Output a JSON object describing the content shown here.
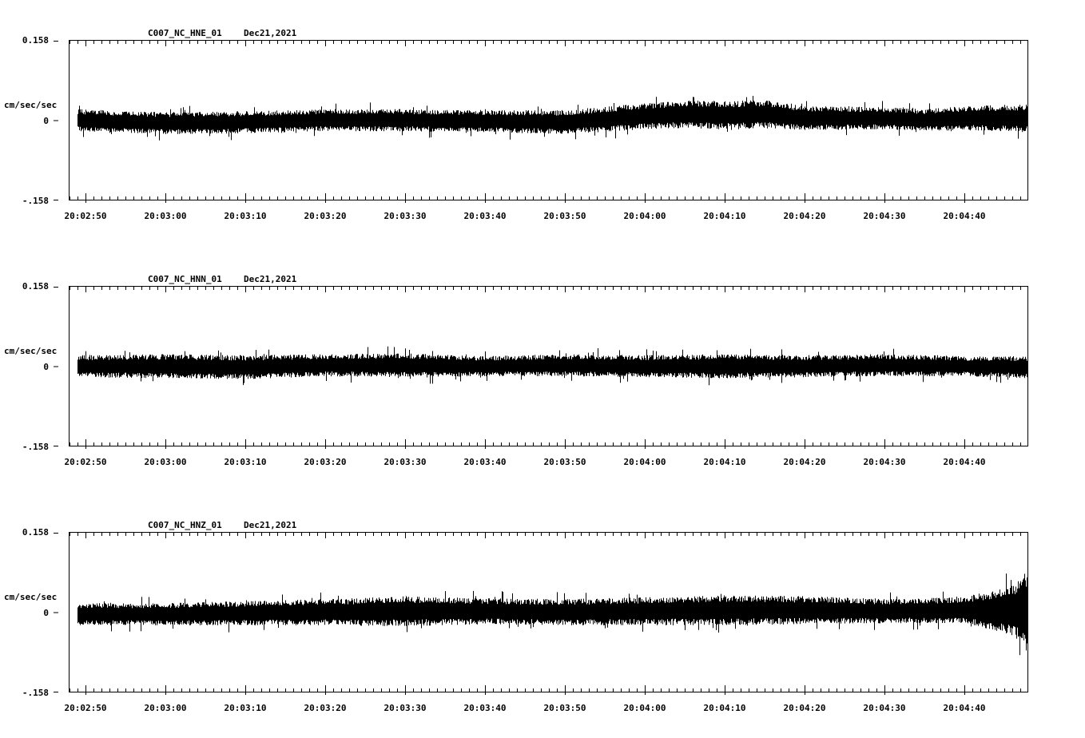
{
  "chart_data": [
    {
      "type": "line",
      "title": "C007_NC_HNE_01",
      "date": "Dec21,2021",
      "ylabel": "cm/sec/sec",
      "ylim": [
        -0.158,
        0.158
      ],
      "yticks": [
        "0.158",
        "0",
        "-.158"
      ],
      "x_tick_labels": [
        "20:02:50",
        "20:03:00",
        "20:03:10",
        "20:03:20",
        "20:03:30",
        "20:03:40",
        "20:03:50",
        "20:04:00",
        "20:04:10",
        "20:04:20",
        "20:04:30",
        "20:04:40"
      ],
      "series": [
        {
          "color": "#000000",
          "x_time": [
            "20:02:49",
            "20:02:55",
            "20:03:00",
            "20:03:10",
            "20:03:20",
            "20:03:30",
            "20:03:40",
            "20:03:50",
            "20:04:00",
            "20:04:05",
            "20:04:10",
            "20:04:15",
            "20:04:20",
            "20:04:30",
            "20:04:35",
            "20:04:40",
            "20:04:48"
          ],
          "baseline": [
            0.0,
            -0.004,
            -0.006,
            -0.004,
            0.0,
            0.0,
            -0.002,
            -0.004,
            0.008,
            0.012,
            0.01,
            0.012,
            0.004,
            0.004,
            0.0,
            0.004,
            0.004
          ],
          "envelope": [
            0.022,
            0.022,
            0.022,
            0.022,
            0.022,
            0.022,
            0.022,
            0.024,
            0.026,
            0.028,
            0.028,
            0.028,
            0.024,
            0.022,
            0.022,
            0.024,
            0.028
          ]
        }
      ]
    },
    {
      "type": "line",
      "title": "C007_NC_HNN_01",
      "date": "Dec21,2021",
      "ylabel": "cm/sec/sec",
      "ylim": [
        -0.158,
        0.158
      ],
      "yticks": [
        "0.158",
        "0",
        "-.158"
      ],
      "x_tick_labels": [
        "20:02:50",
        "20:03:00",
        "20:03:10",
        "20:03:20",
        "20:03:30",
        "20:03:40",
        "20:03:50",
        "20:04:00",
        "20:04:10",
        "20:04:20",
        "20:04:30",
        "20:04:40"
      ],
      "series": [
        {
          "color": "#000000",
          "x_time": [
            "20:02:49",
            "20:03:00",
            "20:03:10",
            "20:03:20",
            "20:03:30",
            "20:03:40",
            "20:03:50",
            "20:04:00",
            "20:04:10",
            "20:04:20",
            "20:04:30",
            "20:04:40",
            "20:04:48"
          ],
          "baseline": [
            0.0,
            0.0,
            -0.002,
            0.002,
            0.002,
            0.0,
            0.002,
            0.0,
            0.0,
            0.0,
            0.002,
            0.0,
            -0.002
          ],
          "envelope": [
            0.022,
            0.024,
            0.024,
            0.022,
            0.024,
            0.02,
            0.022,
            0.022,
            0.024,
            0.022,
            0.022,
            0.02,
            0.022
          ]
        }
      ]
    },
    {
      "type": "line",
      "title": "C007_NC_HNZ_01",
      "date": "Dec21,2021",
      "ylabel": "cm/sec/sec",
      "ylim": [
        -0.158,
        0.158
      ],
      "yticks": [
        "0.158",
        "0",
        "-.158"
      ],
      "x_tick_labels": [
        "20:02:50",
        "20:03:00",
        "20:03:10",
        "20:03:20",
        "20:03:30",
        "20:03:40",
        "20:03:50",
        "20:04:00",
        "20:04:10",
        "20:04:20",
        "20:04:30",
        "20:04:40"
      ],
      "series": [
        {
          "color": "#000000",
          "x_time": [
            "20:02:49",
            "20:03:00",
            "20:03:10",
            "20:03:20",
            "20:03:30",
            "20:03:40",
            "20:03:50",
            "20:04:00",
            "20:04:10",
            "20:04:20",
            "20:04:30",
            "20:04:40",
            "20:04:46",
            "20:04:48"
          ],
          "baseline": [
            -0.004,
            -0.004,
            -0.002,
            0.0,
            0.002,
            0.002,
            0.0,
            0.002,
            0.004,
            0.004,
            0.002,
            0.004,
            0.004,
            0.004
          ],
          "envelope": [
            0.022,
            0.022,
            0.024,
            0.026,
            0.03,
            0.026,
            0.026,
            0.028,
            0.03,
            0.028,
            0.024,
            0.026,
            0.05,
            0.09
          ]
        }
      ]
    }
  ]
}
